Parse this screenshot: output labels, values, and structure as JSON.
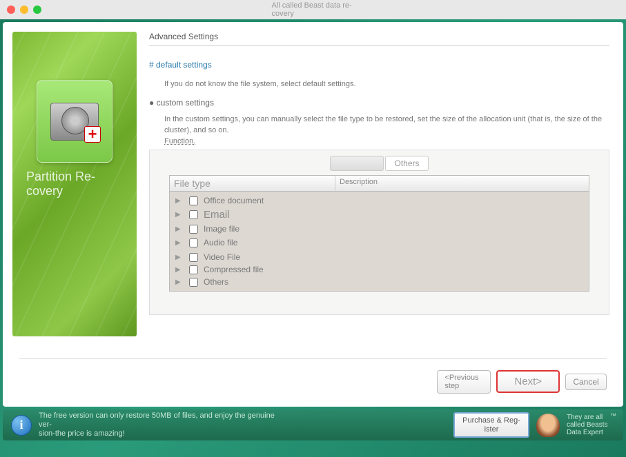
{
  "window": {
    "title": "All called Beast data re-\ncovery"
  },
  "sidebar": {
    "title": "Partition Re-\ncovery"
  },
  "content": {
    "section": "Advanced Settings",
    "default_link": "# default settings",
    "default_desc": "If you do not know the file system, select default settings.",
    "custom_bullet": "● custom settings",
    "custom_desc": "In the custom settings, you can manually select the file type to be restored, set the size of the allocation unit (that is, the size of the cluster), and so on.",
    "function_label": "Function."
  },
  "tabs": {
    "active": "",
    "others": "Others"
  },
  "grid": {
    "col1": "File type",
    "col2": "Description",
    "rows": [
      {
        "label": "Office document"
      },
      {
        "label": "Email"
      },
      {
        "label": "Image file"
      },
      {
        "label": "Audio file"
      },
      {
        "label": "Video File"
      },
      {
        "label": "Compressed file"
      },
      {
        "label": "Others"
      }
    ]
  },
  "buttons": {
    "prev": "<Previous step",
    "next": "Next>",
    "cancel": "Cancel"
  },
  "footer": {
    "info": "The free version can only restore 50MB of files, and enjoy the genuine ver-\nsion-the price is amazing!",
    "purchase": "Purchase & Reg-\nister",
    "slogan": "They are all called Beasts Data Expert",
    "tm": "™"
  }
}
